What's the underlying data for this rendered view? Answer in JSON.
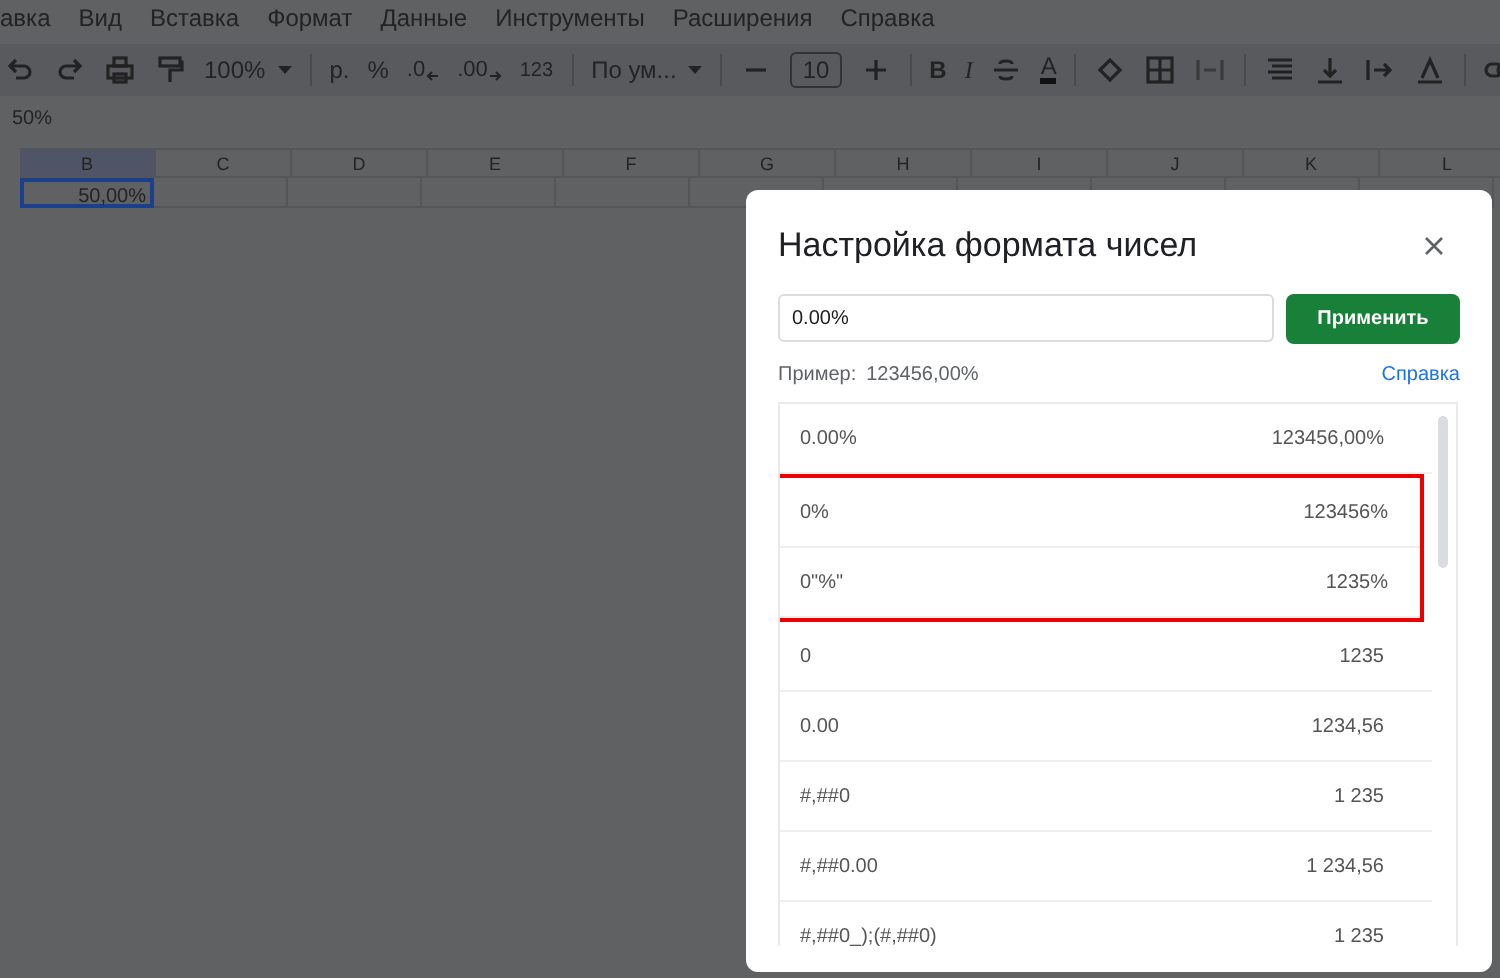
{
  "menu": [
    "авка",
    "Вид",
    "Вставка",
    "Формат",
    "Данные",
    "Инструменты",
    "Расширения",
    "Справка"
  ],
  "toolbar": {
    "zoom": "100%",
    "currency": "р.",
    "percent": "%",
    "decrease_decimals": ".0",
    "increase_decimals": ".00",
    "more_formats": "123",
    "font": "По ум...",
    "font_size": "10",
    "bold": "B",
    "italic": "I",
    "text_color": "A"
  },
  "formula_bar": {
    "value": "50%"
  },
  "columns": [
    {
      "label": "B",
      "selected": true
    },
    {
      "label": "C",
      "selected": false
    },
    {
      "label": "D",
      "selected": false
    },
    {
      "label": "E",
      "selected": false
    },
    {
      "label": "F",
      "selected": false
    },
    {
      "label": "G",
      "selected": false
    },
    {
      "label": "H",
      "selected": false
    },
    {
      "label": "I",
      "selected": false
    },
    {
      "label": "J",
      "selected": false
    },
    {
      "label": "K",
      "selected": false
    },
    {
      "label": "L",
      "selected": false
    }
  ],
  "rows": [
    {
      "cells": [
        {
          "value": "50,00%",
          "selected": true
        }
      ]
    }
  ],
  "dialog": {
    "title": "Настройка формата чисел",
    "input_value": "0.00%",
    "apply_button": "Применить",
    "example_label": "Пример:",
    "example_value": "123456,00%",
    "help_link": "Справка",
    "formats": [
      {
        "pattern": "0.00%",
        "sample": "123456,00%",
        "highlighted": false
      },
      {
        "pattern": "0%",
        "sample": "123456%",
        "highlighted": true
      },
      {
        "pattern": "0\"%\"",
        "sample": "1235%",
        "highlighted": true
      },
      {
        "pattern": "0",
        "sample": "1235",
        "highlighted": false
      },
      {
        "pattern": "0.00",
        "sample": "1234,56",
        "highlighted": false
      },
      {
        "pattern": "#,##0",
        "sample": "1 235",
        "highlighted": false
      },
      {
        "pattern": "#,##0.00",
        "sample": "1 234,56",
        "highlighted": false
      },
      {
        "pattern": "#,##0_);(#,##0)",
        "sample": "1 235",
        "highlighted": false
      }
    ]
  }
}
